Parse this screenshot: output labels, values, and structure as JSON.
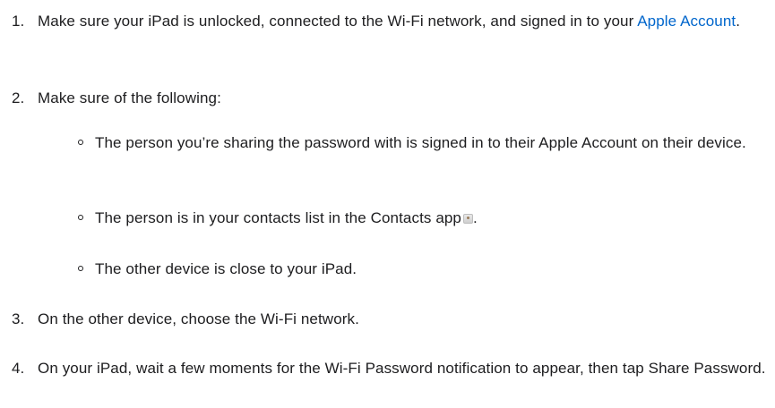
{
  "steps": [
    {
      "number": "1.",
      "text_before": "Make sure your iPad is unlocked, connected to the Wi-Fi network, and signed in to your ",
      "link": "Apple Account",
      "text_after": "."
    },
    {
      "number": "2.",
      "text": "Make sure of the following:",
      "subitems": [
        {
          "text": "The person you’re sharing the password with is signed in to their Apple Account on their device."
        },
        {
          "text_before": "The person is in your contacts list in the Contacts app",
          "icon": "contacts-app-icon",
          "text_after": "."
        },
        {
          "text": "The other device is close to your iPad."
        }
      ]
    },
    {
      "number": "3.",
      "text": "On the other device, choose the Wi-Fi network."
    },
    {
      "number": "4.",
      "text": "On your iPad, wait a few moments for the Wi-Fi Password notification to appear, then tap Share Password."
    }
  ],
  "colors": {
    "text": "#1d1d1f",
    "link": "#0066cc"
  }
}
